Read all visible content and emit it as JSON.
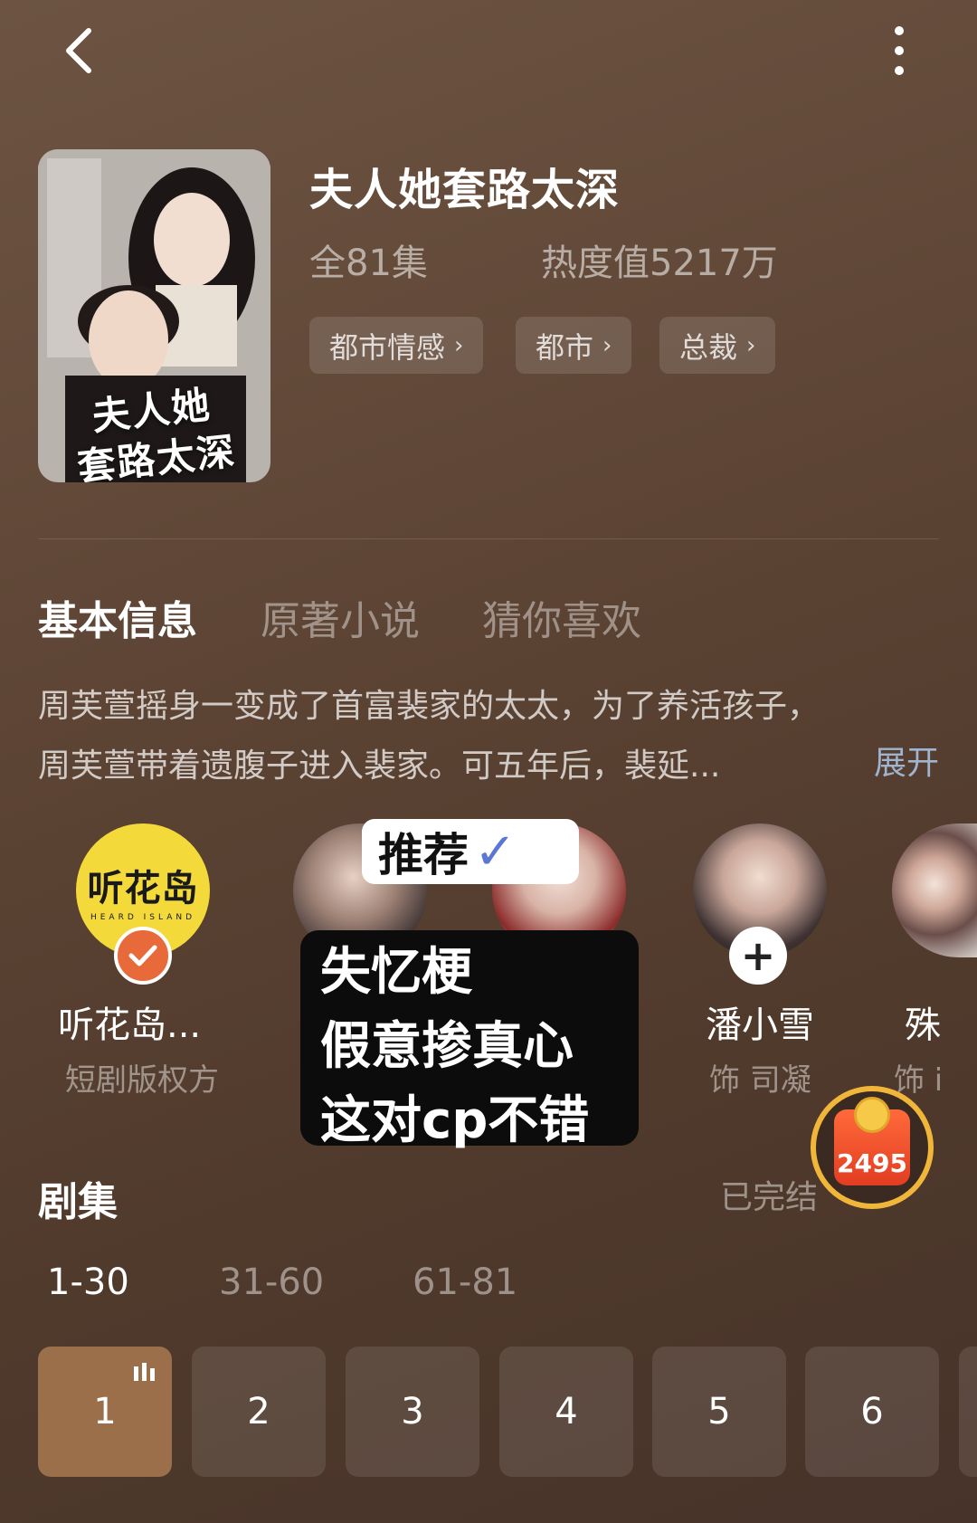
{
  "header": {
    "back_icon": "chevron-left-icon",
    "more_icon": "more-vertical-icon"
  },
  "show": {
    "poster_title_line1": "夫人她",
    "poster_title_line2": "套路太深",
    "title": "夫人她套路太深",
    "episodes_total": "全81集",
    "heat": "热度值5217万",
    "tags": [
      "都市情感",
      "都市",
      "总裁"
    ]
  },
  "tabs": [
    {
      "label": "基本信息",
      "active": true
    },
    {
      "label": "原著小说",
      "active": false
    },
    {
      "label": "猜你喜欢",
      "active": false
    }
  ],
  "synopsis": {
    "line1": "周芙萱摇身一变成了首富裴家的太太，为了养活孩子，",
    "line2": "周芙萱带着遗腹子进入裴家。可五年后，裴延...",
    "expand_label": "展开"
  },
  "cast": [
    {
      "name": "听花岛...",
      "role": "短剧版权方",
      "logo": "听花岛",
      "logo_sub": "HEARD ISLAND"
    },
    {
      "name": "潘小雪",
      "role": "饰 司凝"
    },
    {
      "name": "殊",
      "role": "饰 i"
    }
  ],
  "stickers": {
    "recommend": "推荐",
    "recommend_check": "✓",
    "note_line1": "失忆梗",
    "note_line2": "假意掺真心",
    "note_line3": "这对cp不错"
  },
  "reward": {
    "count": "2495"
  },
  "episodes_section": {
    "title": "剧集",
    "status": "已完结",
    "ranges": [
      {
        "label": "1-30",
        "active": true
      },
      {
        "label": "31-60",
        "active": false
      },
      {
        "label": "61-81",
        "active": false
      }
    ],
    "items": [
      "1",
      "2",
      "3",
      "4",
      "5",
      "6"
    ],
    "current": "1"
  },
  "colors": {
    "background": "#5f4636",
    "accent_episode": "#9b6f4a",
    "expand_link": "#9fb4cf",
    "badge_orange": "#e86a3a",
    "logo_yellow": "#f4d93b"
  }
}
